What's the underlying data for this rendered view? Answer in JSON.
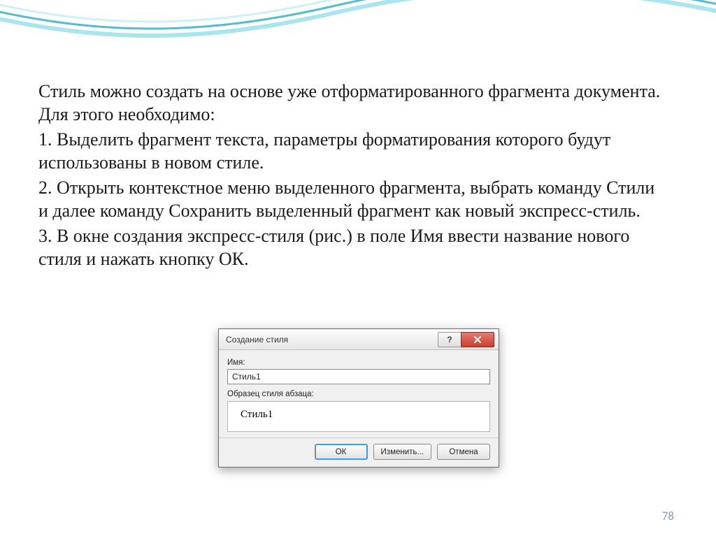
{
  "body": {
    "intro": "Стиль можно создать на основе уже отформатированного фрагмента документа. Для этого необходимо:",
    "step1": "1. Выделить фрагмент текста, параметры форматирования которого будут использованы в новом стиле.",
    "step2": "2. Открыть контекстное меню выделенного фрагмента, выбрать команду Стили и далее команду Сохранить выделенный фрагмент как новый экспресс-стиль.",
    "step3": "3. В окне создания экспресс-стиля (рис.) в поле Имя ввести название нового стиля и нажать кнопку ОК."
  },
  "dialog": {
    "title": "Создание стиля",
    "help_glyph": "?",
    "name_label": "Имя:",
    "name_value": "Стиль1",
    "sample_label": "Образец стиля абзаца:",
    "sample_value": "Стиль1",
    "ok": "ОК",
    "modify": "Изменить...",
    "cancel": "Отмена"
  },
  "page_number": "78"
}
